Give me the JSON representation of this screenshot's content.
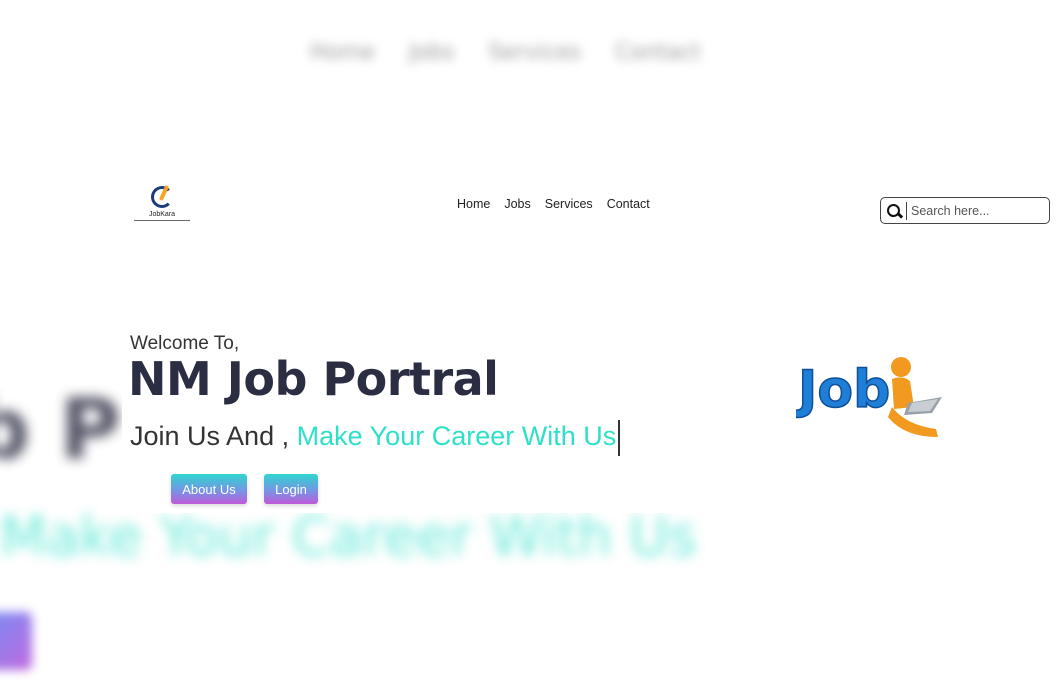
{
  "background": {
    "nav_items": [
      "Home",
      "Jobs",
      "Services",
      "Contact"
    ],
    "title_fragment": "b P",
    "tagline_fragment": "Make Your Career With Us"
  },
  "logo": {
    "name": "JobKara"
  },
  "nav": {
    "items": [
      {
        "label": "Home"
      },
      {
        "label": "Jobs"
      },
      {
        "label": "Services"
      },
      {
        "label": "Contact"
      }
    ]
  },
  "search": {
    "placeholder": "Search here...",
    "value": ""
  },
  "hero": {
    "welcome": "Welcome To,",
    "title": "NM Job Portral",
    "tagline_prefix": "Join Us And ,",
    "tagline_accent": "Make Your Career With Us",
    "about_button": "About Us",
    "login_button": "Login",
    "illustration_text": "Job"
  },
  "colors": {
    "accent": "#2fe0c8",
    "title": "#2b2d42",
    "button_gradient_start": "#2ed6d0",
    "button_gradient_end": "#c05ad8"
  }
}
